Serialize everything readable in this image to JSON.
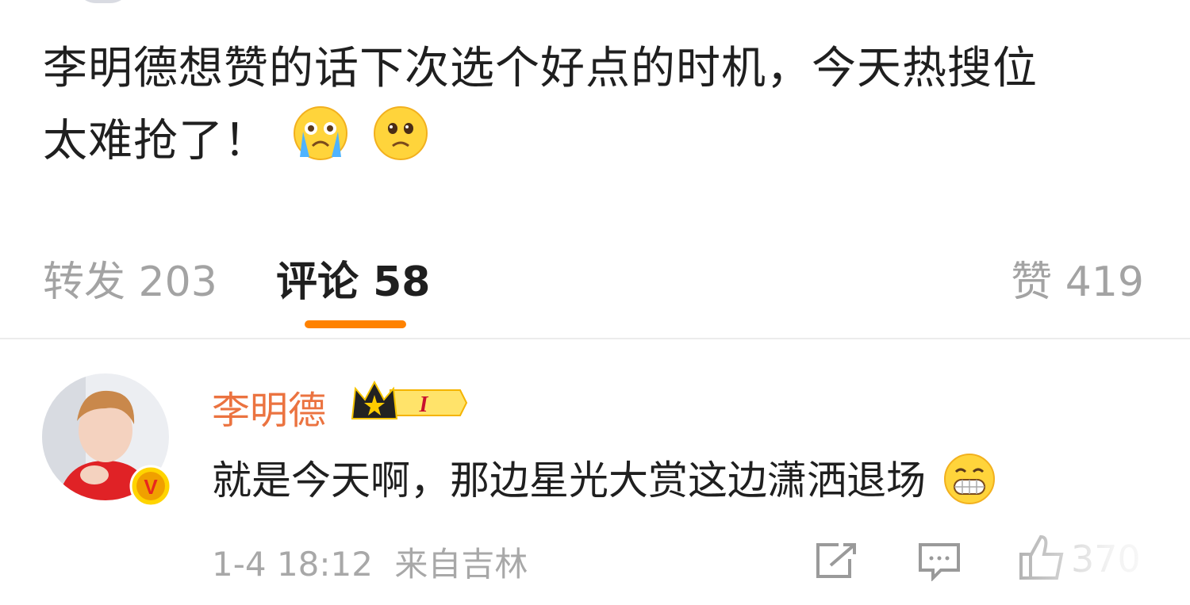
{
  "post": {
    "text_line1": "李明德想赞的话下次选个好点的时机，今天热搜位",
    "text_line2": "太难抢了！"
  },
  "tabs": {
    "repost": "转发 203",
    "comments": "评论 58",
    "likes": "赞 419"
  },
  "comment": {
    "username": "李明德",
    "badge_level": "I",
    "verified_badge": "V",
    "text": "就是今天啊，那边星光大赏这边潇洒退场",
    "date": "1-4 18:12",
    "source": "来自吉林",
    "like_count": "370"
  },
  "colors": {
    "accent": "#ff8200",
    "username": "#eb7340",
    "muted": "#a3a3a3"
  }
}
